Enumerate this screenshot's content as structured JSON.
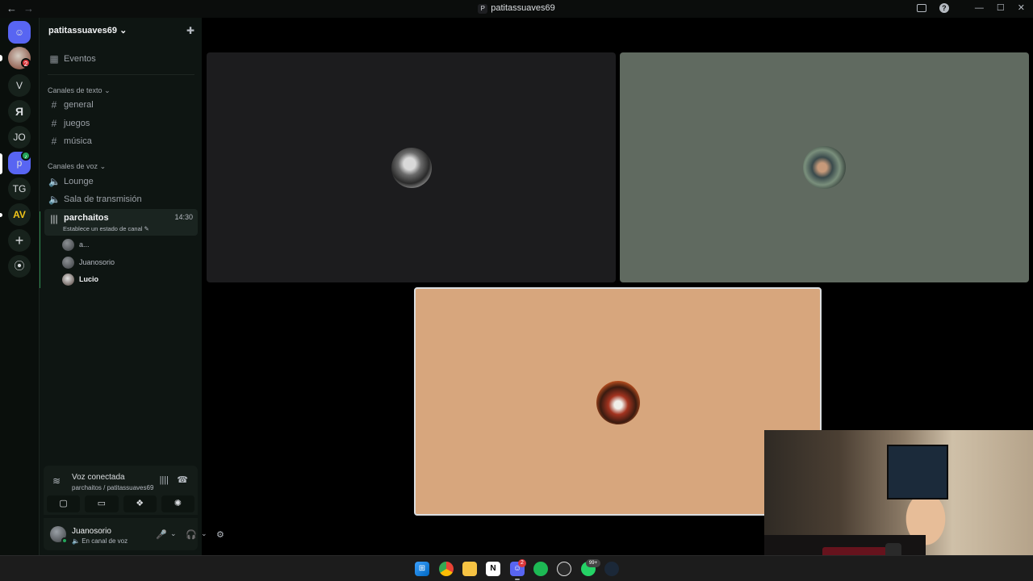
{
  "titlebar": {
    "back_icon": "arrow-left-icon",
    "forward_icon": "arrow-right-icon",
    "server_icon_letter": "P",
    "title": "patitassuaves69"
  },
  "rail": {
    "servers": [
      {
        "label": "V"
      },
      {
        "label": "JO"
      },
      {
        "label": "p",
        "badge_icon": "speaker-icon"
      },
      {
        "label": "TG"
      }
    ],
    "dm_badge": "2"
  },
  "sidebar": {
    "server_name": "patitassuaves69",
    "events_label": "Eventos",
    "text_category": "Canales de texto",
    "text_channels": [
      "general",
      "juegos",
      "música"
    ],
    "voice_category": "Canales de voz",
    "voice_channels": [
      "Lounge",
      "Sala de transmisión"
    ],
    "active_voice": {
      "name": "parchaitos",
      "time": "14:30",
      "status_prompt": "Establece un estado de canal"
    },
    "members": [
      "a...",
      "Juanosorio",
      "Lucio"
    ]
  },
  "voice_panel": {
    "state": "Voz conectada",
    "channel": "parchaitos / patitassuaves69"
  },
  "user_panel": {
    "name": "Juanosorio",
    "status": "En canal de voz"
  },
  "colors": {
    "tile_1": "#1c1c1e",
    "tile_2": "#606a60",
    "tile_3": "#d7a67d",
    "accent": "#5865f2",
    "online": "#23a55a"
  },
  "taskbar": {
    "apps": [
      "windows-start-icon",
      "chrome-icon",
      "file-explorer-icon",
      "notion-icon",
      "discord-icon",
      "spotify-icon",
      "github-icon",
      "whatsapp-icon",
      "steam-icon"
    ],
    "discord_badge": "2",
    "whatsapp_badge": "99+"
  }
}
